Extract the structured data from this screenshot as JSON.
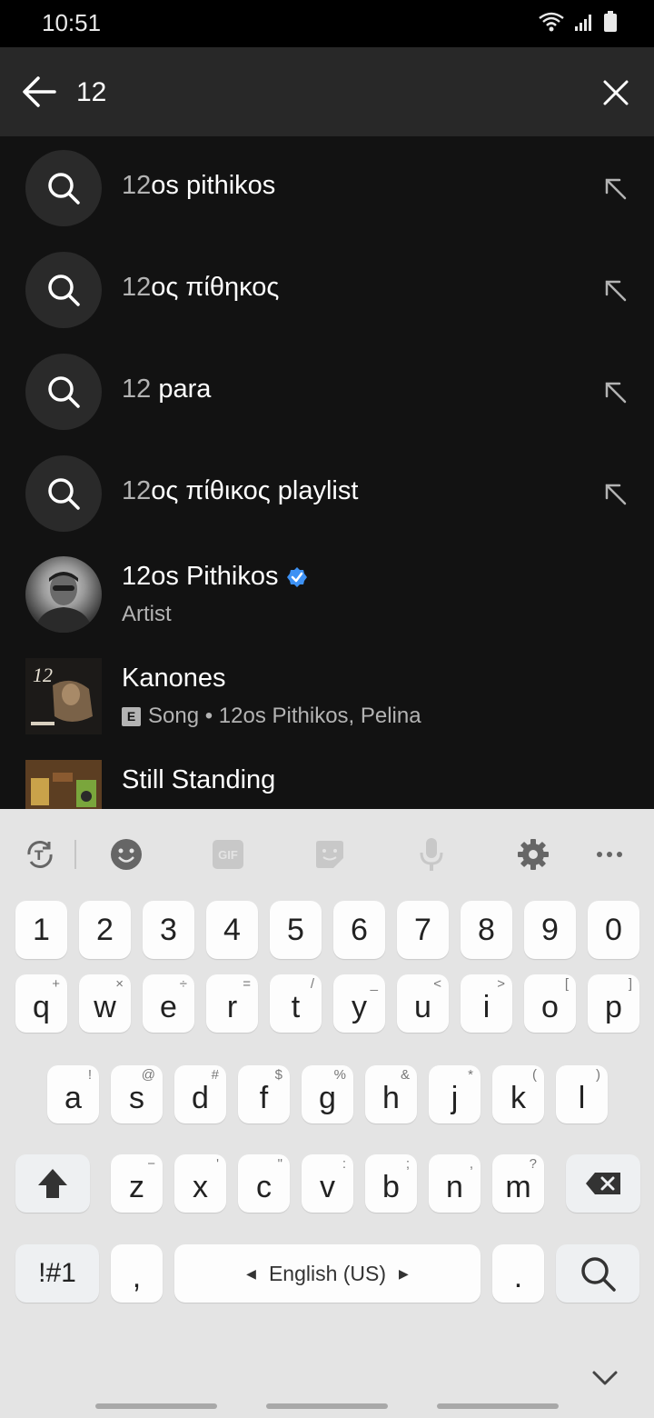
{
  "status_bar": {
    "time": "10:51"
  },
  "search": {
    "value": "12",
    "placeholder": ""
  },
  "suggestions": [
    {
      "match": "12",
      "rest": "os pithikos"
    },
    {
      "match": "12",
      "rest": "ος πίθηκος"
    },
    {
      "match": "12",
      "rest": " para"
    },
    {
      "match": "12",
      "rest": "ος πίθικος playlist"
    }
  ],
  "media_results": [
    {
      "title": "12os Pithikos",
      "subtitle": "Artist",
      "verified": true
    },
    {
      "title": "Kanones",
      "subtitle": "Song • 12os Pithikos, Pelina",
      "explicit_label": "E"
    },
    {
      "title": "Still Standing"
    }
  ],
  "keyboard": {
    "toolbar": [
      "translate-icon",
      "emoji-icon",
      "gif-icon",
      "sticker-icon",
      "microphone-icon",
      "settings-icon",
      "more-icon"
    ],
    "gif_label": "GIF",
    "number_row": [
      "1",
      "2",
      "3",
      "4",
      "5",
      "6",
      "7",
      "8",
      "9",
      "0"
    ],
    "row1": [
      {
        "k": "q",
        "h": "+"
      },
      {
        "k": "w",
        "h": "×"
      },
      {
        "k": "e",
        "h": "÷"
      },
      {
        "k": "r",
        "h": "="
      },
      {
        "k": "t",
        "h": "/"
      },
      {
        "k": "y",
        "h": "_"
      },
      {
        "k": "u",
        "h": "<"
      },
      {
        "k": "i",
        "h": ">"
      },
      {
        "k": "o",
        "h": "["
      },
      {
        "k": "p",
        "h": "]"
      }
    ],
    "row2": [
      {
        "k": "a",
        "h": "!"
      },
      {
        "k": "s",
        "h": "@"
      },
      {
        "k": "d",
        "h": "#"
      },
      {
        "k": "f",
        "h": "$"
      },
      {
        "k": "g",
        "h": "%"
      },
      {
        "k": "h",
        "h": "&"
      },
      {
        "k": "j",
        "h": "*"
      },
      {
        "k": "k",
        "h": "("
      },
      {
        "k": "l",
        "h": ")"
      }
    ],
    "row3": [
      {
        "k": "z",
        "h": "−"
      },
      {
        "k": "x",
        "h": "'"
      },
      {
        "k": "c",
        "h": "\""
      },
      {
        "k": "v",
        "h": ":"
      },
      {
        "k": "b",
        "h": ";"
      },
      {
        "k": "n",
        "h": ","
      },
      {
        "k": "m",
        "h": "?"
      }
    ],
    "symbols_label": "!#1",
    "comma_label": ",",
    "space_label": "English (US)",
    "period_label": "."
  }
}
